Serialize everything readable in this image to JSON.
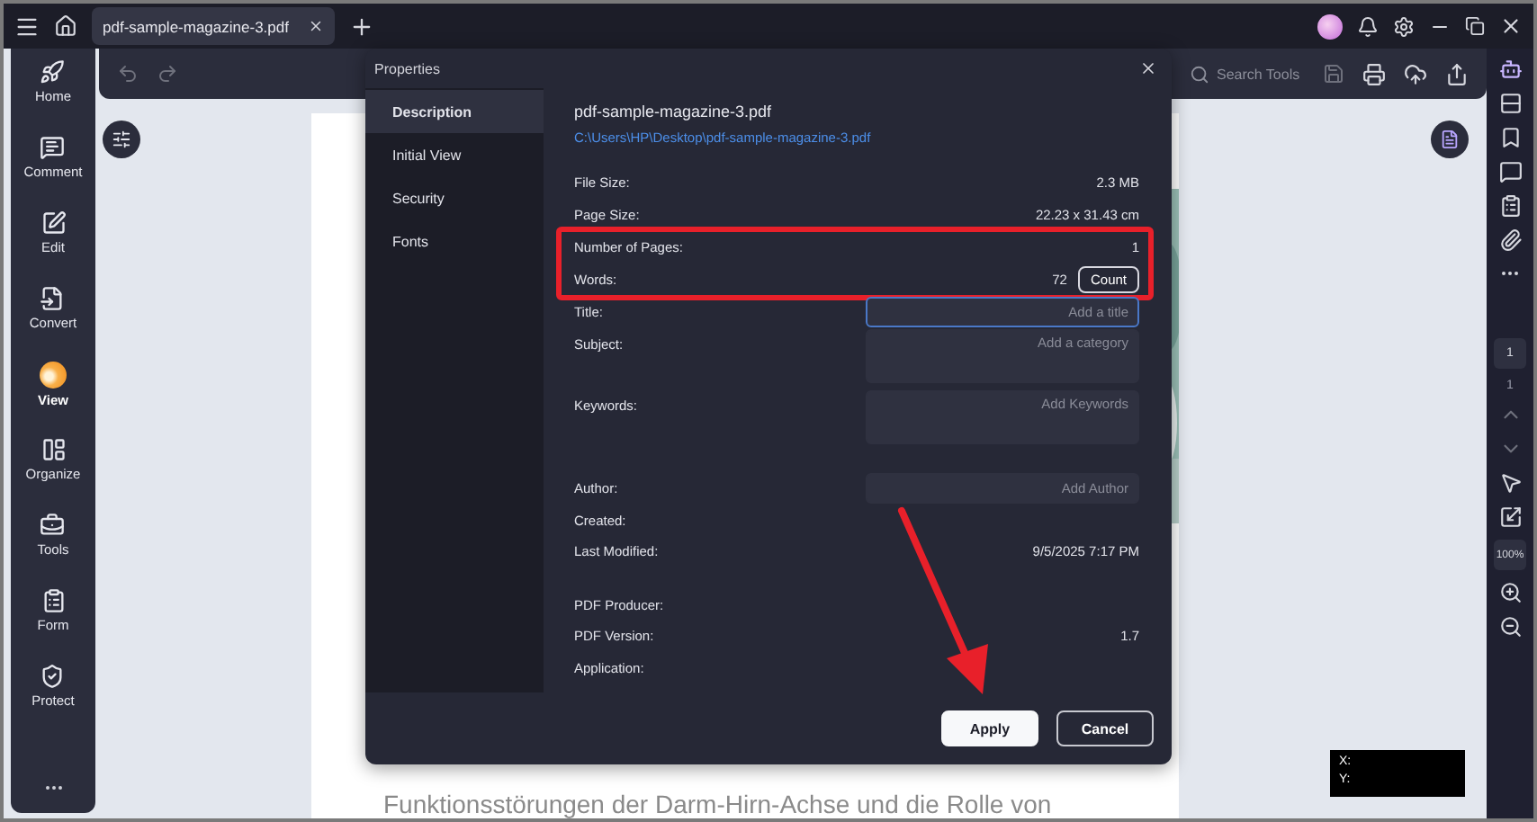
{
  "title_bar": {
    "tabs": [
      {
        "label": "pdf-sample-magazine-3.pdf",
        "selected": true
      }
    ]
  },
  "left_nav": [
    {
      "label": "Home",
      "selected": false
    },
    {
      "label": "Comment",
      "selected": false
    },
    {
      "label": "Edit",
      "selected": false
    },
    {
      "label": "Convert",
      "selected": false
    },
    {
      "label": "View",
      "selected": true
    },
    {
      "label": "Organize",
      "selected": false
    },
    {
      "label": "Tools",
      "selected": false
    },
    {
      "label": "Form",
      "selected": false
    },
    {
      "label": "Protect",
      "selected": false
    }
  ],
  "toolbar": {
    "search": {
      "placeholder": "Search Tools"
    }
  },
  "document": {
    "text": "Funktionsstörungen der Darm-Hirn-Achse und die Rolle von"
  },
  "right_sidebar": {
    "page_current": "1",
    "page_total": "1",
    "zoom": "100%"
  },
  "coordinates": {
    "x_label": "X:",
    "y_label": "Y:"
  },
  "dialog": {
    "title": "Properties",
    "tabs": [
      {
        "label": "Description",
        "selected": true
      },
      {
        "label": "Initial View",
        "selected": false
      },
      {
        "label": "Security",
        "selected": false
      },
      {
        "label": "Fonts",
        "selected": false
      }
    ],
    "file_name": "pdf-sample-magazine-3.pdf",
    "file_path": "C:\\Users\\HP\\Desktop\\pdf-sample-magazine-3.pdf",
    "groups": [
      {
        "highlighted": false,
        "gap_before": true,
        "rows": [
          {
            "kind": "text",
            "label": "File Size:",
            "value": "2.3 MB"
          },
          {
            "kind": "text",
            "label": "Page Size:",
            "value": "22.23 x 31.43 cm"
          }
        ]
      },
      {
        "highlighted": true,
        "gap_before": false,
        "rows": [
          {
            "kind": "text",
            "label": "Number of Pages:",
            "value": "1"
          },
          {
            "kind": "count",
            "label": "Words:",
            "value": "72",
            "button": "Count"
          }
        ]
      },
      {
        "highlighted": false,
        "gap_before": false,
        "rows": [
          {
            "kind": "field",
            "label": "Title:",
            "placeholder": "Add a title",
            "multiline": false,
            "focused": true
          },
          {
            "kind": "field",
            "label": "Subject:",
            "placeholder": "Add a category",
            "multiline": true,
            "focused": false
          },
          {
            "kind": "field",
            "label": "Keywords:",
            "placeholder": "Add Keywords",
            "multiline": true,
            "focused": false
          }
        ]
      },
      {
        "highlighted": false,
        "gap_before": true,
        "rows": [
          {
            "kind": "field",
            "label": "Author:",
            "placeholder": "Add Author",
            "multiline": false,
            "focused": false
          },
          {
            "kind": "text",
            "label": "Created:"
          },
          {
            "kind": "text",
            "label": "Last Modified:",
            "value": "9/5/2025 7:17 PM"
          }
        ]
      },
      {
        "highlighted": false,
        "gap_before": true,
        "rows": [
          {
            "kind": "text",
            "label": "PDF Producer:"
          },
          {
            "kind": "text",
            "label": "PDF Version:",
            "value": "1.7"
          },
          {
            "kind": "text",
            "label": "Application:"
          }
        ]
      }
    ],
    "buttons": [
      {
        "label": "Apply",
        "kind": "primary"
      },
      {
        "label": "Cancel",
        "kind": "secondary"
      }
    ]
  }
}
